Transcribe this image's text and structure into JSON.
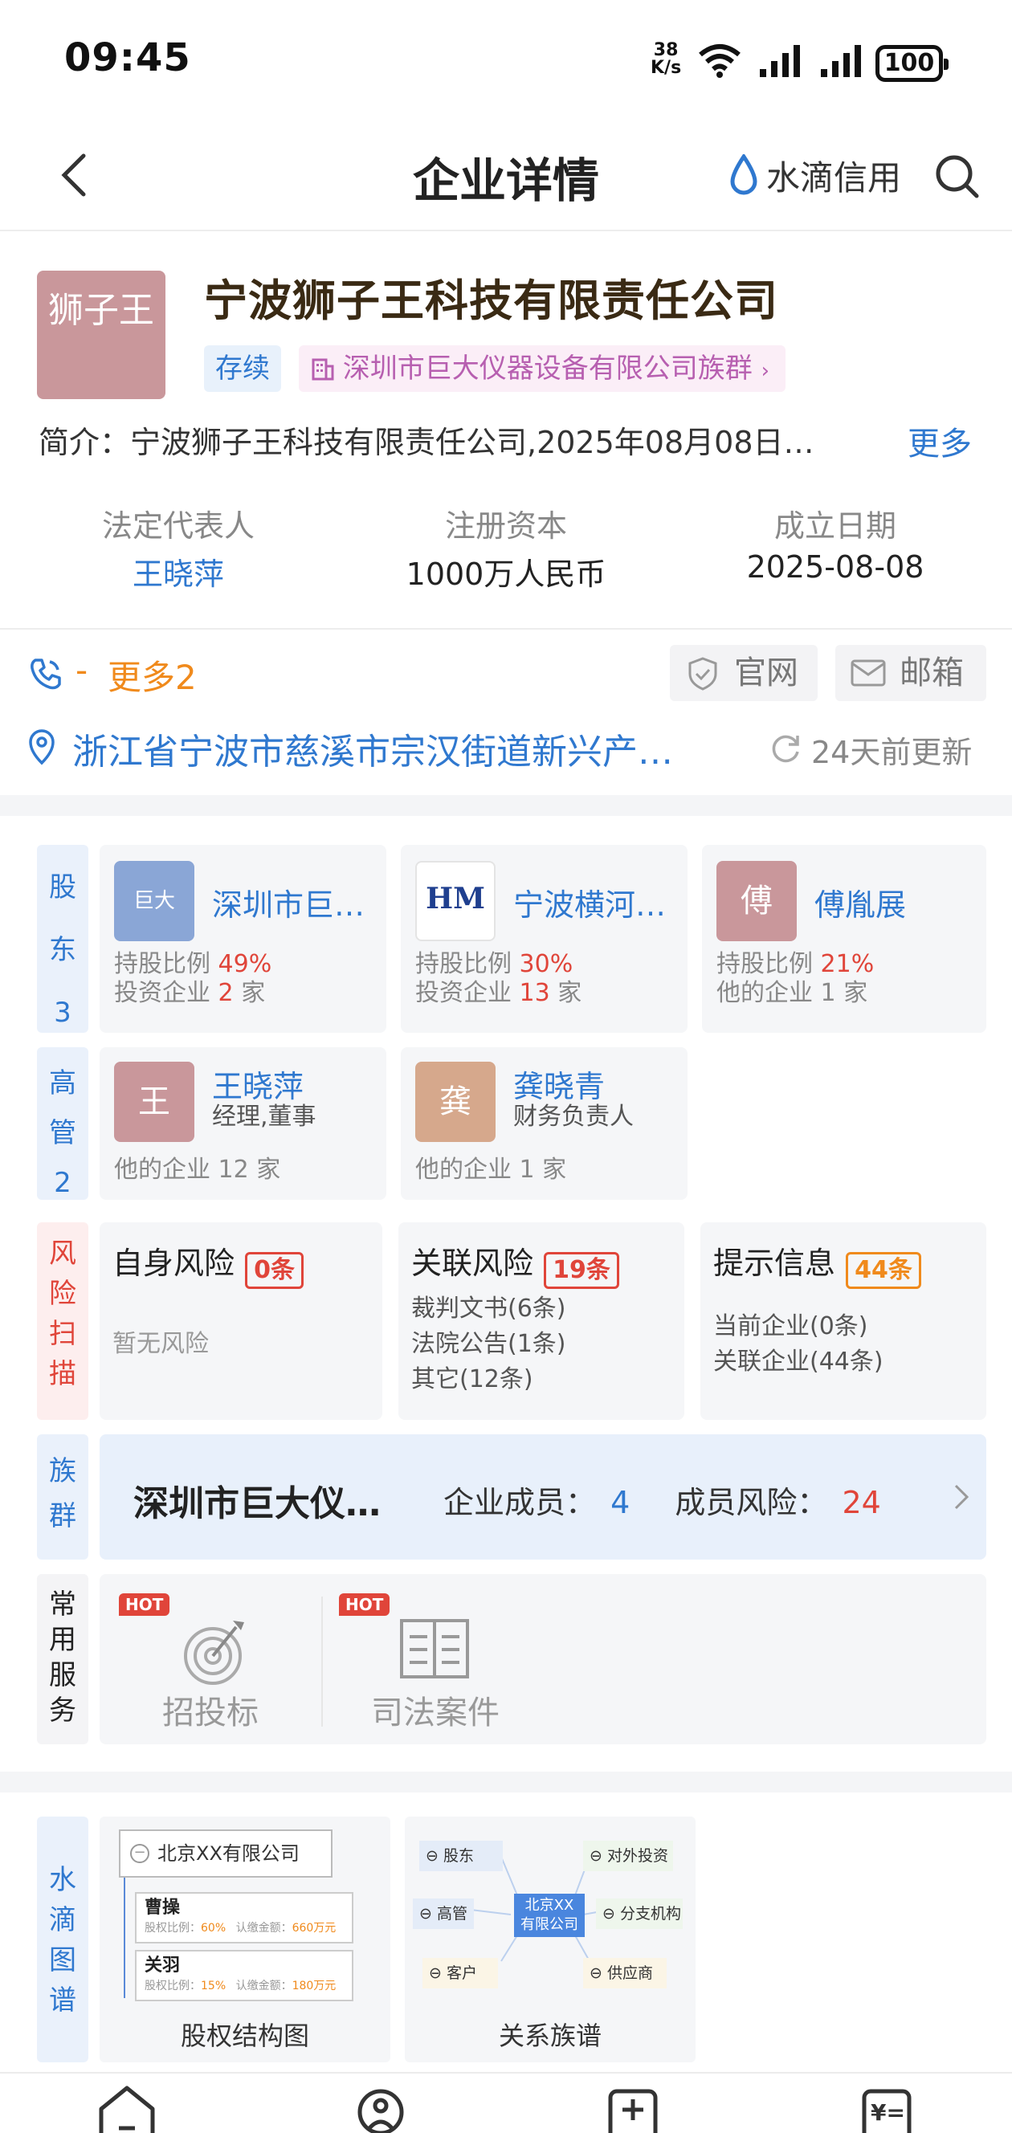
{
  "status_bar": {
    "time": "09:45",
    "speed_value": "38",
    "speed_unit": "K/s",
    "battery": "100"
  },
  "nav": {
    "title": "企业详情",
    "brand": "水滴信用"
  },
  "company": {
    "logo_text": "狮子王",
    "name": "宁波狮子王科技有限责任公司",
    "status_tag": "存续",
    "group_tag": "深圳市巨大仪器设备有限公司族群",
    "intro": "简介：宁波狮子王科技有限责任公司,2025年08月08日…",
    "intro_more": "更多",
    "legal_rep_label": "法定代表人",
    "legal_rep": "王晓萍",
    "capital_label": "注册资本",
    "capital": "1000万人民币",
    "founded_label": "成立日期",
    "founded": "2025-08-08"
  },
  "contact": {
    "phone": "-",
    "more": "更多2",
    "website": "官网",
    "email": "邮箱",
    "address": "浙江省宁波市慈溪市宗汉街道新兴产…",
    "updated": "24天前更新"
  },
  "shareholders": {
    "label": "股东3",
    "items": [
      {
        "avatar": "巨大",
        "name": "深圳市巨…",
        "ratio_label": "持股比例",
        "ratio": "49%",
        "sub_prefix": "投资企业",
        "sub_count": "2",
        "sub_suffix": "家",
        "color": "#8aa6d6"
      },
      {
        "avatar": "HM",
        "name": "宁波横河…",
        "ratio_label": "持股比例",
        "ratio": "30%",
        "sub_prefix": "投资企业",
        "sub_count": "13",
        "sub_suffix": "家",
        "color": "#ffffff"
      },
      {
        "avatar": "傅",
        "name": "傅胤展",
        "ratio_label": "持股比例",
        "ratio": "21%",
        "sub_prefix": "他的企业",
        "sub_count": "1",
        "sub_suffix": "家",
        "color": "#c9979b"
      }
    ]
  },
  "executives": {
    "label": "高管2",
    "items": [
      {
        "avatar": "王",
        "name": "王晓萍",
        "role": "经理,董事",
        "sub": "他的企业 12 家",
        "color": "#c9979b"
      },
      {
        "avatar": "龚",
        "name": "龚晓青",
        "role": "财务负责人",
        "sub": "他的企业 1 家",
        "color": "#d6a88c"
      }
    ]
  },
  "risk": {
    "label": "风险扫描",
    "self": {
      "title": "自身风险",
      "badge": "0条",
      "text": "暂无风险"
    },
    "related": {
      "title": "关联风险",
      "badge": "19条",
      "lines": [
        "裁判文书(6条)",
        "法院公告(1条)",
        "其它(12条)"
      ]
    },
    "hint": {
      "title": "提示信息",
      "badge": "44条",
      "lines": [
        "当前企业(0条)",
        "关联企业(44条)"
      ]
    }
  },
  "group": {
    "label": "族群",
    "name": "深圳市巨大仪…",
    "members_label": "企业成员：",
    "members": "4",
    "risk_label": "成员风险：",
    "risk": "24"
  },
  "services": {
    "label": "常用服务",
    "items": [
      {
        "hot": "HOT",
        "label": "招投标"
      },
      {
        "hot": "HOT",
        "label": "司法案件"
      }
    ]
  },
  "graph": {
    "label": "水滴图谱",
    "equity": {
      "label": "股权结构图",
      "root": "北京XX有限公司",
      "nodes": [
        {
          "name": "曹操",
          "ratio_label": "股权比例：",
          "ratio": "60%",
          "amount_label": "认缴金额：",
          "amount": "660万元"
        },
        {
          "name": "关羽",
          "ratio_label": "股权比例：",
          "ratio": "15%",
          "amount_label": "认缴金额：",
          "amount": "180万元"
        }
      ]
    },
    "relation": {
      "label": "关系族谱",
      "center_line1": "北京XX",
      "center_line2": "有限公司",
      "nodes": [
        "股东",
        "对外投资",
        "高管",
        "分支机构",
        "客户",
        "供应商"
      ]
    }
  },
  "colors": {
    "blue": "#2f78cf",
    "red": "#e0453a",
    "orange": "#f08a1c"
  }
}
